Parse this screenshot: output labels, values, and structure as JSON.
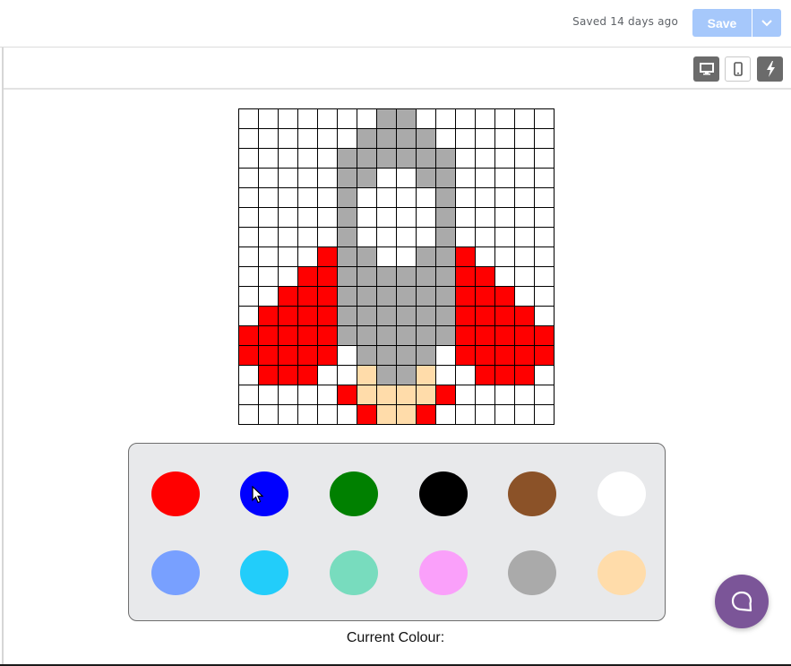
{
  "header": {
    "saved_status": "Saved 14 days ago",
    "save_label": "Save",
    "dropdown_icon": "chevron-down-icon"
  },
  "toolbar": {
    "buttons": [
      {
        "name": "desktop-view",
        "icon": "desktop-icon",
        "active": true
      },
      {
        "name": "mobile-view",
        "icon": "mobile-icon",
        "active": false
      },
      {
        "name": "flash",
        "icon": "lightning-icon",
        "active": true
      }
    ]
  },
  "colors": {
    "W": "#ffffff",
    "G": "#aaaaaa",
    "R": "#ff0000",
    "P": "#ffdcaa"
  },
  "pixel_grid": [
    "WWWWWWWGGWWWWWWW",
    "WWWWWWGGGGWWWWWW",
    "WWWWWGGGGGGWWWWW",
    "WWWWWGGWWGGWWWWW",
    "WWWWWGWWWWGWWWWW",
    "WWWWWGWWWWGWWWWW",
    "WWWWWGWWWWGWWWWW",
    "WWWWRGGWWGGRWWWW",
    "WWWRRGGGGGGRRWWW",
    "WWRRRGGGGGGRRRWW",
    "WRRRRGGGGGGRRRRW",
    "RRRRRGGGGGGRRRRR",
    "RRRRRWGGGGWRRRRR",
    "WRRRWWPGGPWWRRRW",
    "WWWWWRPPPPRWWWWW",
    "WWWWWWRPPRWWWWWW"
  ],
  "palette": {
    "swatches": [
      {
        "name": "red",
        "color": "#ff0000"
      },
      {
        "name": "blue",
        "color": "#0000ff"
      },
      {
        "name": "green",
        "color": "#008000"
      },
      {
        "name": "black",
        "color": "#000000"
      },
      {
        "name": "brown",
        "color": "#8b5228"
      },
      {
        "name": "white",
        "color": "#ffffff"
      },
      {
        "name": "light-blue",
        "color": "#78a0ff"
      },
      {
        "name": "cyan",
        "color": "#22cdfa"
      },
      {
        "name": "mint",
        "color": "#78dcbe"
      },
      {
        "name": "pink",
        "color": "#faa0fa"
      },
      {
        "name": "gray",
        "color": "#aaaaaa"
      },
      {
        "name": "peach",
        "color": "#ffdcaa"
      }
    ]
  },
  "current_colour": {
    "label": "Current Colour:"
  },
  "chat": {
    "icon": "chat-bubble-icon",
    "color": "#7b5598"
  }
}
